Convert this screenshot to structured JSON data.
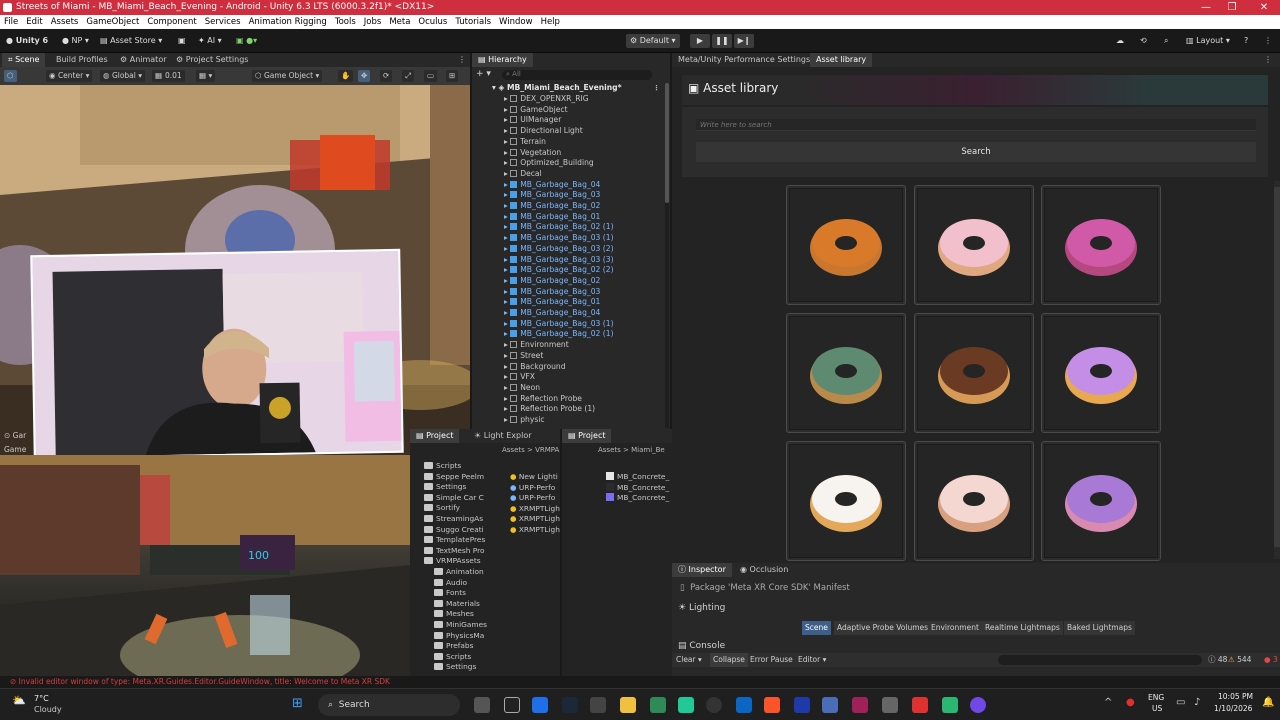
{
  "window": {
    "title": "Streets of Miami - MB_Miami_Beach_Evening - Android - Unity 6.3 LTS (6000.3.2f1)* <DX11>"
  },
  "menu": [
    "File",
    "Edit",
    "Assets",
    "GameObject",
    "Component",
    "Services",
    "Animation Rigging",
    "Tools",
    "Jobs",
    "Meta",
    "Oculus",
    "Tutorials",
    "Window",
    "Help"
  ],
  "toolbar": {
    "unity": "Unity 6",
    "np": "NP",
    "asset_store": "Asset Store",
    "ai": "AI",
    "play_mode": "Default",
    "layout": "Layout"
  },
  "scene_tabs": [
    "Scene",
    "Build Profiles",
    "Animator",
    "Project Settings"
  ],
  "scene_tools": {
    "center": "Center",
    "global": "Global",
    "snap": "0.01",
    "view": "Game Object"
  },
  "hierarchy": {
    "tab": "Hierarchy",
    "search": "All",
    "root": "MB_Miami_Beach_Evening*",
    "items": [
      {
        "name": "DEX_OPENXR_RIG",
        "blue": false
      },
      {
        "name": "GameObject",
        "blue": false
      },
      {
        "name": "UIManager",
        "blue": false
      },
      {
        "name": "Directional Light",
        "blue": false
      },
      {
        "name": "Terrain",
        "blue": false
      },
      {
        "name": "Vegetation",
        "blue": false
      },
      {
        "name": "Optimized_Building",
        "blue": false
      },
      {
        "name": "Decal",
        "blue": false
      },
      {
        "name": "MB_Garbage_Bag_04",
        "blue": true
      },
      {
        "name": "MB_Garbage_Bag_03",
        "blue": true
      },
      {
        "name": "MB_Garbage_Bag_02",
        "blue": true
      },
      {
        "name": "MB_Garbage_Bag_01",
        "blue": true
      },
      {
        "name": "MB_Garbage_Bag_02 (1)",
        "blue": true
      },
      {
        "name": "MB_Garbage_Bag_03 (1)",
        "blue": true
      },
      {
        "name": "MB_Garbage_Bag_03 (2)",
        "blue": true
      },
      {
        "name": "MB_Garbage_Bag_03 (3)",
        "blue": true
      },
      {
        "name": "MB_Garbage_Bag_02 (2)",
        "blue": true
      },
      {
        "name": "MB_Garbage_Bag_02",
        "blue": true
      },
      {
        "name": "MB_Garbage_Bag_03",
        "blue": true
      },
      {
        "name": "MB_Garbage_Bag_01",
        "blue": true
      },
      {
        "name": "MB_Garbage_Bag_04",
        "blue": true
      },
      {
        "name": "MB_Garbage_Bag_03 (1)",
        "blue": true
      },
      {
        "name": "MB_Garbage_Bag_02 (1)",
        "blue": true
      },
      {
        "name": "Environment",
        "blue": false
      },
      {
        "name": "Street",
        "blue": false
      },
      {
        "name": "Background",
        "blue": false
      },
      {
        "name": "VFX",
        "blue": false
      },
      {
        "name": "Neon",
        "blue": false
      },
      {
        "name": "Reflection Probe",
        "blue": false
      },
      {
        "name": "Reflection Probe (1)",
        "blue": false
      },
      {
        "name": "physic",
        "blue": false
      }
    ]
  },
  "right_tabs": [
    "Meta/Unity Performance Settings...",
    "Asset library"
  ],
  "asset_library": {
    "title": "Asset library",
    "placeholder": "Write here to search",
    "search_button": "Search"
  },
  "donuts": [
    {
      "glaze": "#d9792a",
      "base": "#c9772f"
    },
    {
      "glaze": "#f2c0cc",
      "base": "#e0a880"
    },
    {
      "glaze": "#d05aa8",
      "base": "#b5487f"
    },
    {
      "glaze": "#5f8a72",
      "base": "#b98a4a"
    },
    {
      "glaze": "#6a3a22",
      "base": "#d69a56"
    },
    {
      "glaze": "#c58ee6",
      "base": "#e8a850"
    },
    {
      "glaze": "#f7f3ee",
      "base": "#e3a85a"
    },
    {
      "glaze": "#f4d7d0",
      "base": "#d9a080"
    },
    {
      "glaze": "#a87ad6",
      "base": "#d98ab0"
    }
  ],
  "inspector": {
    "tabs": [
      "Inspector",
      "Occlusion"
    ],
    "package": "Package 'Meta XR Core SDK' Manifest",
    "lighting": "Lighting",
    "lighting_tabs": [
      "Scene",
      "Adaptive Probe Volumes",
      "Environment",
      "Realtime Lightmaps",
      "Baked Lightmaps"
    ],
    "console": "Console",
    "console_btns": [
      "Clear",
      "Collapse",
      "Error Pause",
      "Editor"
    ],
    "counts": {
      "info": "48",
      "warn": "544",
      "err": "3"
    }
  },
  "project1": {
    "tab": "Project",
    "tab2": "Light Explor",
    "breadcrumb": "Assets > VRMPA",
    "folders": [
      "Scripts",
      "Seppe Peelm",
      "Settings",
      "Simple Car C",
      "Sortify",
      "StreamingAs",
      "Suggo Creati",
      "TemplatePres",
      "TextMesh Pro",
      "VRMPAssets",
      "Animation",
      "Audio",
      "Fonts",
      "Materials",
      "Meshes",
      "MiniGames",
      "PhysicsMa",
      "Prefabs",
      "Scripts",
      "Settings"
    ],
    "files": [
      "New Lighti",
      "URP-Perfo",
      "URP-Perfo",
      "XRMPTLigh",
      "XRMPTLigh",
      "XRMPTLigh"
    ]
  },
  "project2": {
    "tab": "Project",
    "breadcrumb": "Assets > Miami_Be",
    "files": [
      "MB_Concrete_",
      "MB_Concrete_",
      "MB_Concrete_"
    ]
  },
  "status": "Invalid editor window of type: Meta.XR.Guides.Editor.GuideWindow, title: Welcome to Meta XR SDK",
  "taskbar": {
    "temp": "7°C",
    "weather": "Cloudy",
    "search": "Search",
    "lang": "ENG",
    "region": "US",
    "time": "10:05 PM",
    "date": "1/10/2026"
  }
}
